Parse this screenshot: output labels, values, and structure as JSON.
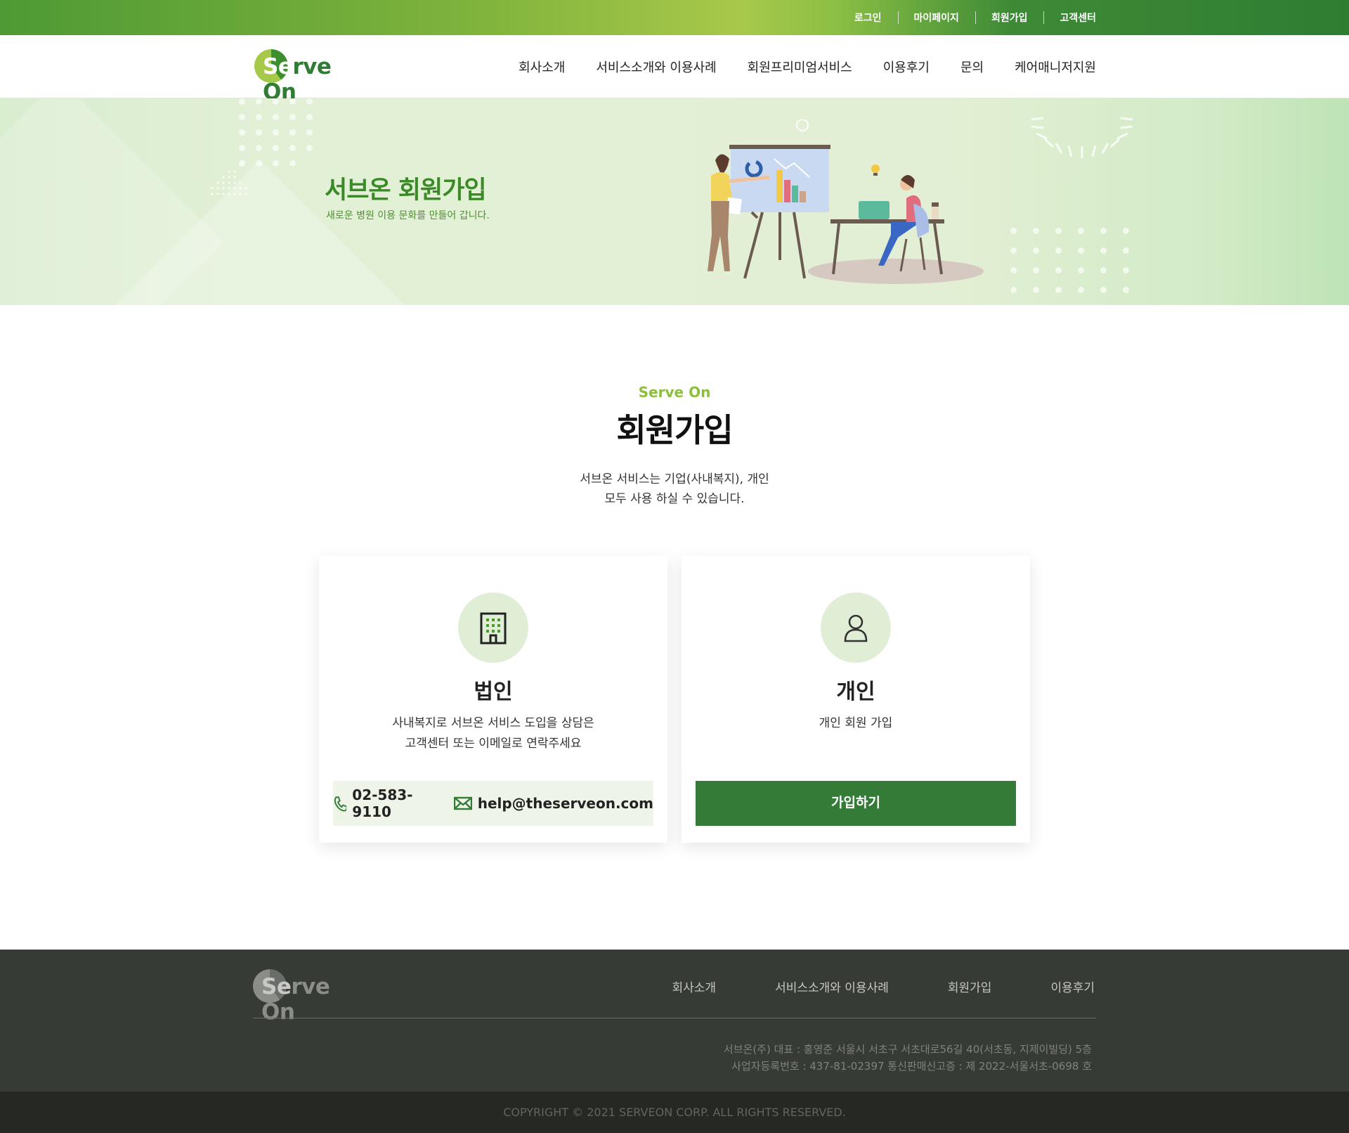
{
  "utility_nav": [
    "로그인",
    "마이페이지",
    "회원가입",
    "고객센터"
  ],
  "brand": {
    "name_s": "Se",
    "name_rest": "rve On"
  },
  "main_nav": [
    "회사소개",
    "서비스소개와 이용사례",
    "회원프리미엄서비스",
    "이용후기",
    "문의",
    "케어매니저지원"
  ],
  "hero": {
    "title_a": "서브온 ",
    "title_b": "회원가입",
    "subtitle": "새로운 병원 이용 문화를 만들어 갑니다."
  },
  "section": {
    "kicker": "Serve On",
    "title": "회원가입",
    "desc_line1": "서브온 서비스는 기업(사내복지), 개인",
    "desc_line2": "모두 사용 하실 수 있습니다."
  },
  "cards": {
    "corporate": {
      "icon": "building-icon",
      "title": "법인",
      "line1": "사내복지로 서브온 서비스 도입을 상담은",
      "line2": "고객센터 또는 이메일로  연락주세요",
      "phone": "02-583-9110",
      "email": "help@theserveon.com"
    },
    "personal": {
      "icon": "user-icon",
      "title": "개인",
      "line1": "개인 회원 가입",
      "button": "가입하기"
    }
  },
  "footer": {
    "nav": [
      "회사소개",
      "서비스소개와 이용사례",
      "회원가입",
      "이용후기"
    ],
    "info_line1": "서브온(주) 대표 : 홍영준 서울시 서초구 서초대로56길 40(서초동, 지제이빌딩) 5층",
    "info_line2": "사업자등록번호 : 437-81-02397  통신판매신고증 : 제 2022-서울서초-0698 호",
    "copyright": "COPYRIGHT © 2021 SERVEON CORP. ALL RIGHTS RESERVED."
  },
  "colors": {
    "brand_green": "#347b38",
    "accent_lime": "#8bbf3c",
    "footer_bg": "#373b36"
  }
}
